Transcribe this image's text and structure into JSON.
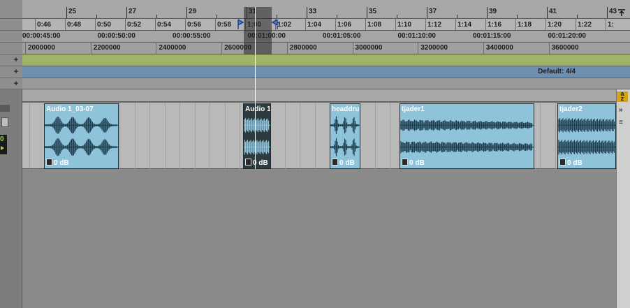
{
  "bars": [
    "25",
    "27",
    "29",
    "31",
    "33",
    "35",
    "37",
    "39",
    "41",
    "43"
  ],
  "min_secs": [
    "0:46",
    "0:48",
    "0:50",
    "0:52",
    "0:54",
    "0:56",
    "0:58",
    "1:00",
    "1:02",
    "1:04",
    "1:06",
    "1:08",
    "1:10",
    "1:12",
    "1:14",
    "1:16",
    "1:18",
    "1:20",
    "1:22",
    "1:"
  ],
  "timecode": [
    "00:00:45:00",
    "00:00:50:00",
    "00:00:55:00",
    "00:01:00:00",
    "00:01:05:00",
    "00:01:10:00",
    "00:01:15:00",
    "00:01:20:00"
  ],
  "samples": [
    "2000000",
    "2200000",
    "2400000",
    "2600000",
    "2800000",
    "3000000",
    "3200000",
    "3400000",
    "3600000"
  ],
  "meter": {
    "label": "Default: 4/4"
  },
  "colors": {
    "marker": "#9eb46a",
    "meter": "#6f8fb1",
    "clip": "#8fc3da",
    "clip_selected": "#2d3b41",
    "az_button": "#d4a312"
  },
  "gutter": {
    "plus": "+",
    "value": "0"
  },
  "scroll": {
    "az": "a\nz"
  },
  "clips": [
    {
      "name": "Audio 1_03-07",
      "gain": "0 dB",
      "selected": false
    },
    {
      "name": "Audio 1",
      "gain": "0 dB",
      "selected": true
    },
    {
      "name": "headdru",
      "gain": "0 dB",
      "selected": false
    },
    {
      "name": "tjader1",
      "gain": "0 dB",
      "selected": false
    },
    {
      "name": "tjader2",
      "gain": "0 dB",
      "selected": false
    }
  ]
}
